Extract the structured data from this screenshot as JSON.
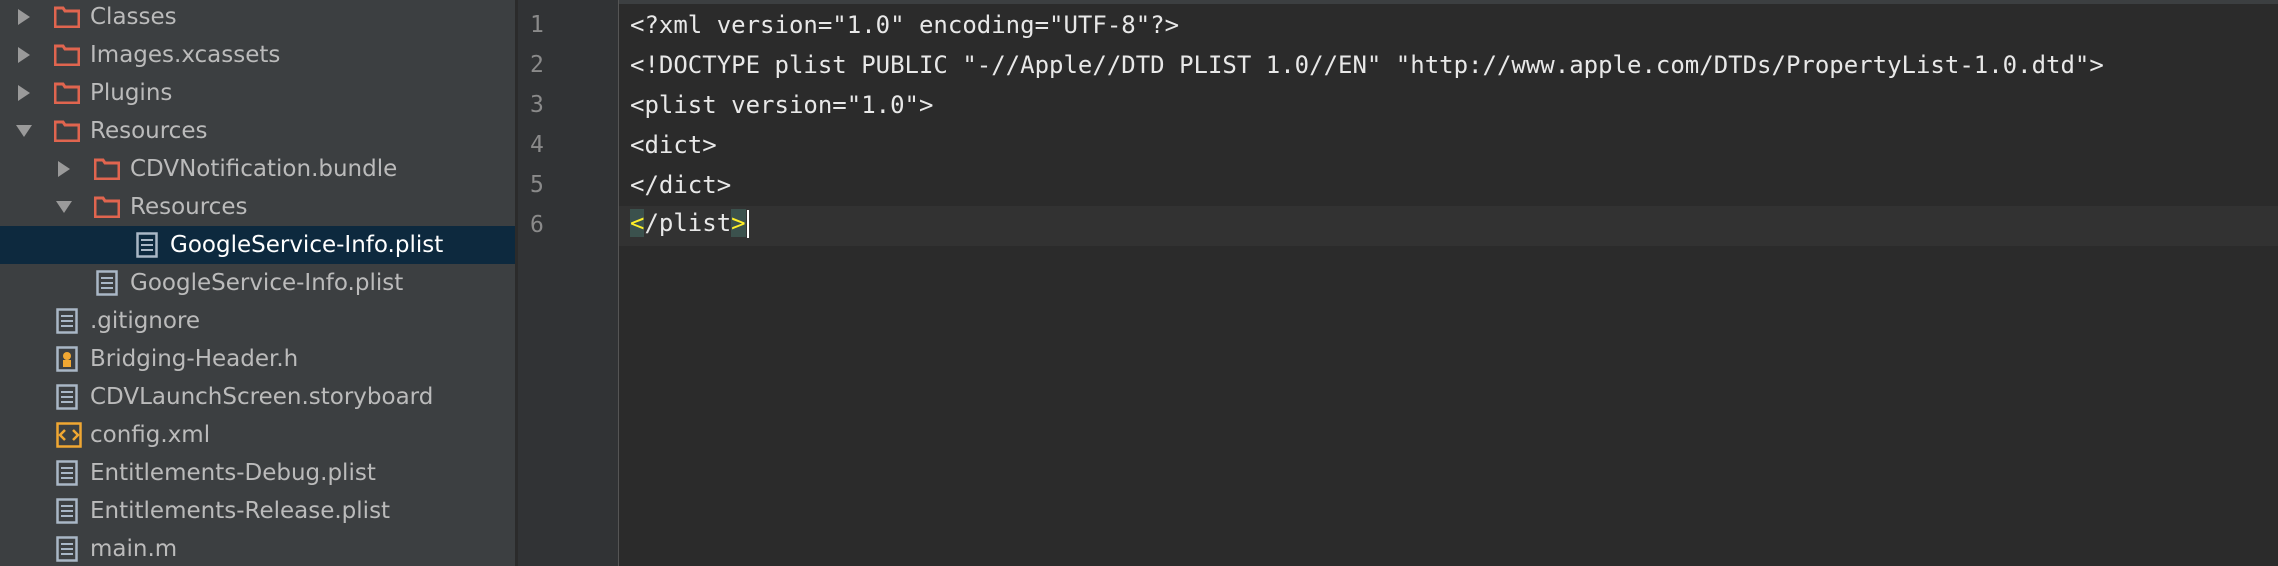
{
  "colors": {
    "folder_icon": "#e0654f",
    "file_icon": "#a9b7c6",
    "xml_icon": "#f0a732",
    "selected_row": "#0d293e",
    "tag_highlight": "#ffef28"
  },
  "file_tree": {
    "items": [
      {
        "label": "Classes",
        "type": "folder",
        "icon": "folder-icon",
        "state": "collapsed"
      },
      {
        "label": "Images.xcassets",
        "type": "folder",
        "icon": "folder-icon",
        "state": "collapsed"
      },
      {
        "label": "Plugins",
        "type": "folder",
        "icon": "folder-icon",
        "state": "collapsed"
      },
      {
        "label": "Resources",
        "type": "folder",
        "icon": "folder-icon",
        "state": "expanded"
      },
      {
        "label": "CDVNotification.bundle",
        "type": "folder",
        "icon": "folder-icon",
        "state": "collapsed"
      },
      {
        "label": "Resources",
        "type": "folder",
        "icon": "folder-icon",
        "state": "expanded"
      },
      {
        "label": "GoogleService-Info.plist",
        "type": "file",
        "icon": "plist-file-icon",
        "selected": true
      },
      {
        "label": "GoogleService-Info.plist",
        "type": "file",
        "icon": "plist-file-icon"
      },
      {
        "label": ".gitignore",
        "type": "file",
        "icon": "text-file-icon"
      },
      {
        "label": "Bridging-Header.h",
        "type": "file",
        "icon": "header-file-icon"
      },
      {
        "label": "CDVLaunchScreen.storyboard",
        "type": "file",
        "icon": "storyboard-file-icon"
      },
      {
        "label": "config.xml",
        "type": "file",
        "icon": "xml-file-icon"
      },
      {
        "label": "Entitlements-Debug.plist",
        "type": "file",
        "icon": "plist-file-icon"
      },
      {
        "label": "Entitlements-Release.plist",
        "type": "file",
        "icon": "plist-file-icon"
      },
      {
        "label": "main.m",
        "type": "file",
        "icon": "source-file-icon"
      }
    ]
  },
  "editor": {
    "line_numbers": [
      "1",
      "2",
      "3",
      "4",
      "5",
      "6"
    ],
    "lines": [
      "<?xml version=\"1.0\" encoding=\"UTF-8\"?>",
      "<!DOCTYPE plist PUBLIC \"-//Apple//DTD PLIST 1.0//EN\" \"http://www.apple.com/DTDs/PropertyList-1.0.dtd\">",
      "<plist version=\"1.0\">",
      "<dict>",
      "</dict>"
    ],
    "last_line": {
      "open_bracket": "<",
      "body": "/plist",
      "close_bracket": ">"
    },
    "current_line": "6"
  }
}
